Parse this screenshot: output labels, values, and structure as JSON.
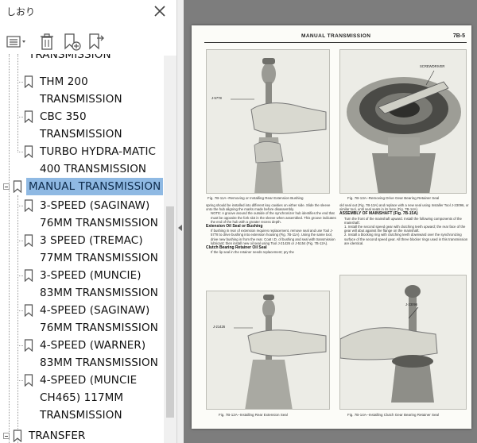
{
  "panel": {
    "title": "しおり",
    "toolbar": {
      "options_label": "options-menu",
      "icons": [
        "list-options-icon",
        "trash-icon",
        "new-bookmark-icon",
        "bookmark-expand-icon"
      ]
    }
  },
  "bookmarks": [
    {
      "lines": [
        "TRANSMISSION"
      ],
      "level": 1
    },
    {
      "lines": [
        "THM 200",
        "TRANSMISSION"
      ],
      "level": 1
    },
    {
      "lines": [
        "CBC 350",
        "TRANSMISSION"
      ],
      "level": 1
    },
    {
      "lines": [
        "TURBO HYDRA-MATIC",
        "400 TRANSMISSION"
      ],
      "level": 1
    },
    {
      "lines": [
        "MANUAL TRANSMISSION"
      ],
      "level": 0,
      "selected": true
    },
    {
      "lines": [
        "3-SPEED (SAGINAW)",
        "76MM TRANSMISSION"
      ],
      "level": 1
    },
    {
      "lines": [
        "3 SPEED (TREMAC)",
        "77MM TRANSMISSION"
      ],
      "level": 1
    },
    {
      "lines": [
        "3-SPEED (MUNCIE)",
        "83MM TRANSMISSION"
      ],
      "level": 1
    },
    {
      "lines": [
        "4-SPEED (SAGINAW)",
        "76MM TRANSMISSION"
      ],
      "level": 1
    },
    {
      "lines": [
        "4-SPEED (WARNER)",
        "83MM TRANSMISSION"
      ],
      "level": 1
    },
    {
      "lines": [
        "4-SPEED (MUNCIE",
        "CH465) 117MM",
        "TRANSMISSION"
      ],
      "level": 1
    },
    {
      "lines": [
        "TRANSFER"
      ],
      "level": 0
    }
  ],
  "document": {
    "header_title": "MANUAL TRANSMISSION",
    "page_number": "7B-5",
    "fig1": {
      "label": "J-5778",
      "caption": "Fig. 7B-11A--Removing or Installing Rear Extension Bushing"
    },
    "fig2": {
      "label": "SCREWDRIVER",
      "caption": "Fig. 7B-13A--Removing Drive Gear Bearing Retainer Seal"
    },
    "fig3": {
      "label": "J-21426",
      "caption": "Fig. 7B-12A--Installing Rear Extension Seal"
    },
    "fig4": {
      "label": "J-23096",
      "caption": "Fig. 7B-14A--Installing Clutch Gear Bearing Retainer Seal"
    },
    "left_col": {
      "para1": "spring should be installed into different key cavities on either side. Slide the sleeve onto the hub aligning the marks made before disassembly.",
      "note": "NOTE: A groove around the outside of the synchronizer hub identifies the end that must be opposite the fork slot in the sleeve when assembled. This groove indicates the end of the hub with a greater recess depth.",
      "heading1": "Extension Oil Seal or Bushing",
      "para2": "If bushing in rear of extension requires replacement, remove seal and use Tool J-5778 to drive bushing into extension housing (Fig. 7B-11A). Using the same tool, drive new bushing in from the rear. Coat I.D. of bushing and seal with transmission lubricant; then install new oil seal using Tool J-21426 or J-5154 (Fig. 7B-12A).",
      "heading2": "Clutch Bearing Retainer Oil Seal",
      "para3": "If the lip seal in the retainer needs replacement; pry the"
    },
    "right_col": {
      "para1": "old seal out (Fig. 7B-13A) and replace with a new seal using Installer Tool J-23096, or similar tool, until seal seats in its bore (Fig. 7B-14A).",
      "heading1": "ASSEMBLY OF MAINSHAFT (Fig. 7B-15A)",
      "para2": "Turn the front of the mainshaft upward. Install the following components of the mainshaft:",
      "step1": "1. Install the second speed gear with clutching teeth upward; the rear face of the gear will abut against the flange on the mainshaft.",
      "step2": "2. Install a blocking ring with clutching teeth downward over the synchronizing surface of the second speed gear. All three blocker rings used in this transmission are identical."
    }
  },
  "colors": {
    "selection": "#8fb9e3",
    "viewer_bg": "#7d7d7d",
    "page": "#fcfcf8"
  }
}
